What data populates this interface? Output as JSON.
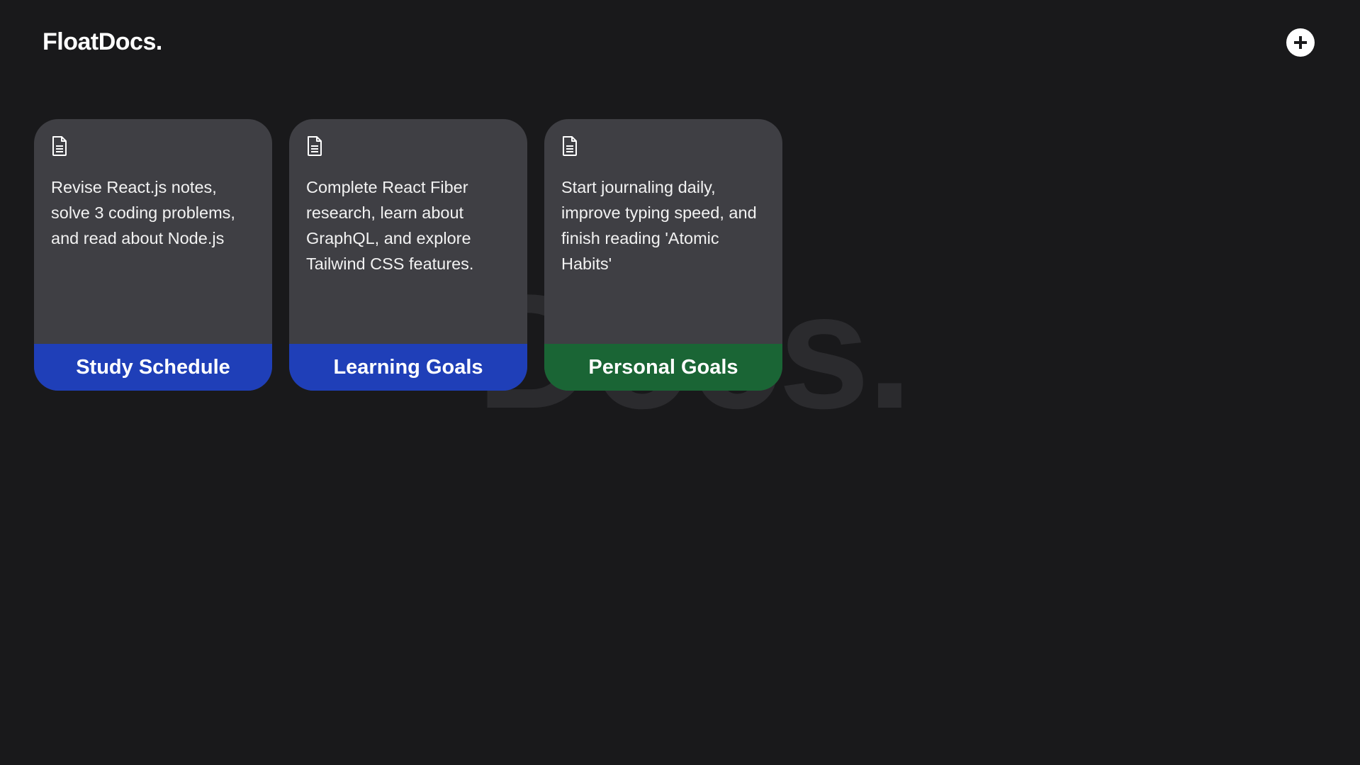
{
  "app": {
    "title": "FloatDocs.",
    "watermark": "Docs."
  },
  "header": {
    "add_button_icon": "plus-circle-icon"
  },
  "cards": [
    {
      "icon": "document-icon",
      "description": "Revise React.js notes, solve 3 coding problems, and read about Node.js",
      "title": "Study Schedule",
      "footer_color": "#1f3fb8"
    },
    {
      "icon": "document-icon",
      "description": "Complete React Fiber research, learn about GraphQL, and explore Tailwind CSS features.",
      "title": "Learning Goals",
      "footer_color": "#1f3fb8"
    },
    {
      "icon": "document-icon",
      "description": "Start journaling daily, improve typing speed, and finish reading 'Atomic Habits'",
      "title": "Personal Goals",
      "footer_color": "#1a6535"
    }
  ]
}
